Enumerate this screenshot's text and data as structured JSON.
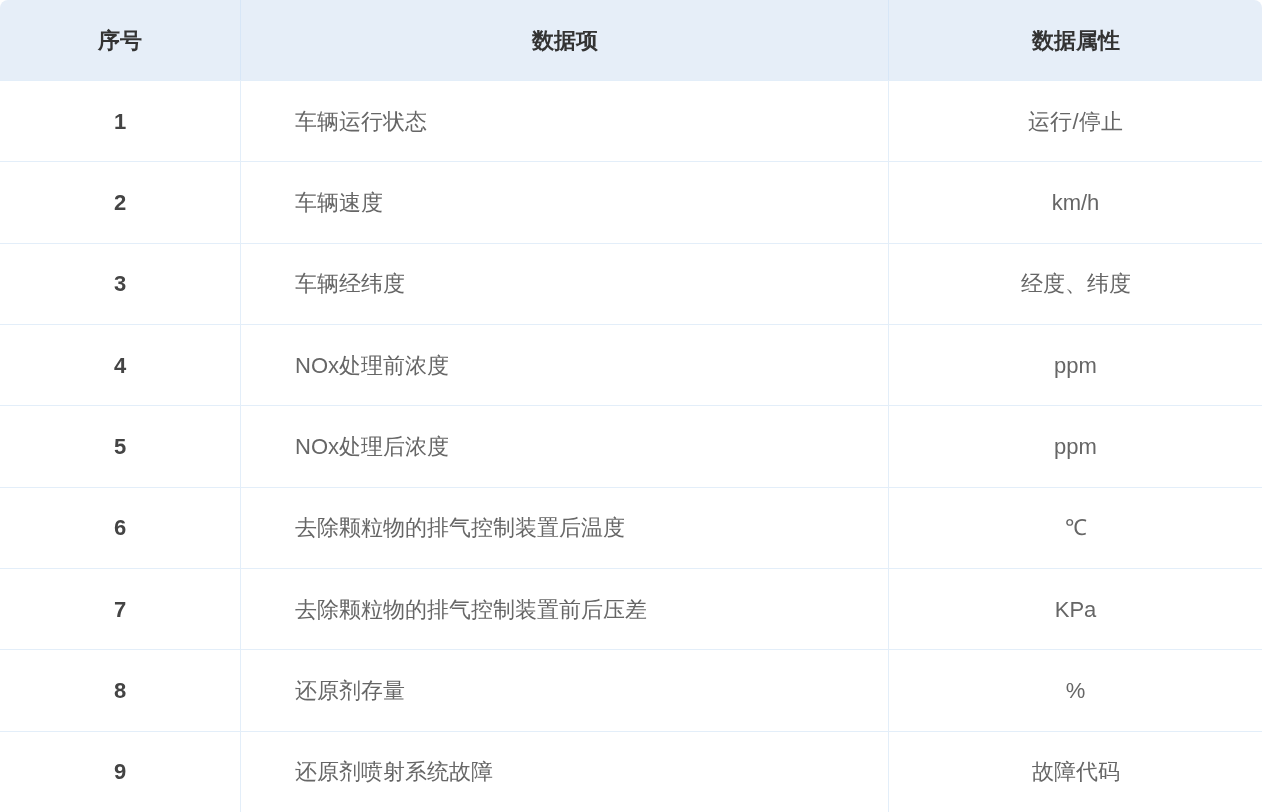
{
  "table": {
    "columns": [
      "序号",
      "数据项",
      "数据属性"
    ],
    "rows": [
      [
        "1",
        "车辆运行状态",
        "运行/停止"
      ],
      [
        "2",
        "车辆速度",
        "km/h"
      ],
      [
        "3",
        "车辆经纬度",
        "经度、纬度"
      ],
      [
        "4",
        "NOx处理前浓度",
        "ppm"
      ],
      [
        "5",
        "NOx处理后浓度",
        "ppm"
      ],
      [
        "6",
        "去除颗粒物的排气控制装置后温度",
        "℃"
      ],
      [
        "7",
        "去除颗粒物的排气控制装置前后压差",
        "KPa"
      ],
      [
        "8",
        "还原剂存量",
        "%"
      ],
      [
        "9",
        "还原剂喷射系统故障",
        "故障代码"
      ]
    ]
  }
}
